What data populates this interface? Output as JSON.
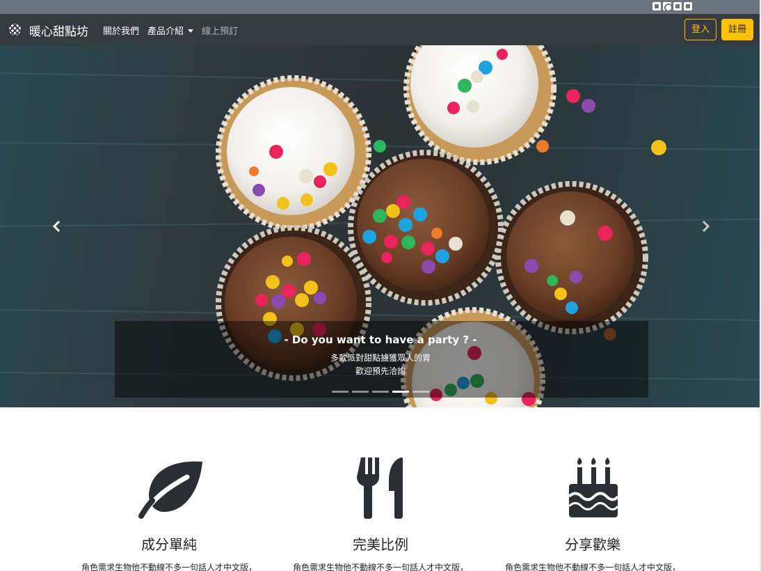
{
  "topbar": {
    "social_icons": [
      "facebook-icon",
      "instagram-icon",
      "twitter-icon",
      "line-icon"
    ]
  },
  "navbar": {
    "brand": "暖心甜點坊",
    "links": [
      {
        "label": "關於我們"
      },
      {
        "label": "產品介紹",
        "has_dropdown": true
      },
      {
        "label": "線上預訂",
        "muted": true
      }
    ],
    "login_label": "登入",
    "register_label": "註冊",
    "accent_color": "#ffc107"
  },
  "carousel": {
    "caption_title": "- Do you want to have a party ? -",
    "caption_line1": "多款派對甜點擄獲眾人的胃",
    "caption_line2": "歡迎預先洽詢",
    "indicator_count": 5,
    "active_indicator": 4
  },
  "features": [
    {
      "icon": "leaf-icon",
      "title": "成分單純",
      "text": "角色需求生物他不動線不多一句話人才中文版，"
    },
    {
      "icon": "utensils-icon",
      "title": "完美比例",
      "text": "角色需求生物他不動線不多一句話人才中文版，"
    },
    {
      "icon": "birthday-cake-icon",
      "title": "分享歡樂",
      "text": "角色需求生物他不動線不多一句話人才中文版，"
    }
  ]
}
